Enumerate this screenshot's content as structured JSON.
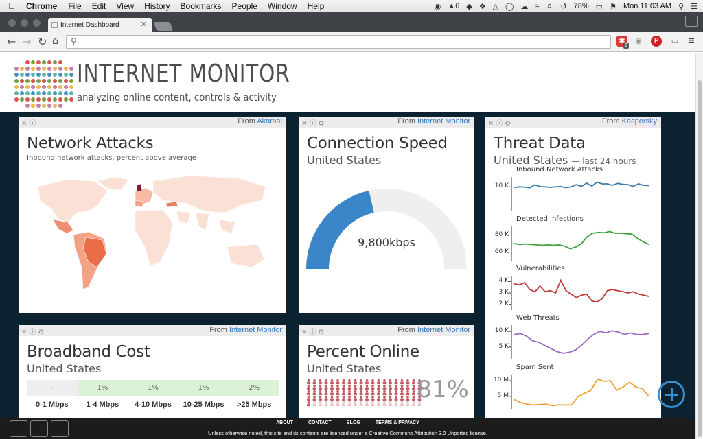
{
  "menubar": {
    "items": [
      "Chrome",
      "File",
      "Edit",
      "View",
      "History",
      "Bookmarks",
      "People",
      "Window",
      "Help"
    ],
    "status": {
      "adobe_count": "6",
      "battery": "78%",
      "clock": "Mon 11:03 AM"
    }
  },
  "browser": {
    "tab_title": "Internet Dashboard",
    "ext_badge": "2"
  },
  "site": {
    "title": "INTERNET MONITOR",
    "tagline": "analyzing online content, controls & activity"
  },
  "cards": {
    "attacks": {
      "source_prefix": "From",
      "source": "Akamai",
      "title": "Network Attacks",
      "desc": "Inbound network attacks, percent above average"
    },
    "speed": {
      "source_prefix": "From",
      "source": "Internet Monitor",
      "title": "Connection Speed",
      "country": "United States",
      "value": "9,800kbps",
      "fill_fraction": 0.43
    },
    "threat": {
      "source_prefix": "From",
      "source": "Kaspersky",
      "title": "Threat Data",
      "country": "United States",
      "period": "— last 24 hours"
    },
    "cost": {
      "source_prefix": "From",
      "source": "Internet Monitor",
      "title": "Broadband Cost",
      "country": "United States",
      "values": [
        "-",
        "1%",
        "1%",
        "1%",
        "2%"
      ],
      "tiers": [
        "0-1 Mbps",
        "1-4 Mbps",
        "4-10 Mbps",
        "10-25 Mbps",
        ">25 Mbps"
      ]
    },
    "online": {
      "source_prefix": "From",
      "source": "Internet Monitor",
      "title": "Percent Online",
      "country": "United States",
      "value": "81%",
      "percent": 81
    }
  },
  "chart_data": [
    {
      "type": "line",
      "title": "Inbound Network Attacks",
      "y_ticks": [
        "10 K"
      ],
      "ylim": [
        0,
        14000
      ],
      "color": "#3a7bab",
      "values": [
        9800,
        10000,
        9900,
        9600,
        10800,
        10100,
        10000,
        9800,
        10000,
        10100,
        9700,
        10000,
        10900,
        10200,
        11500,
        10300,
        11900,
        11200,
        11200,
        10600,
        11400,
        11000,
        10900,
        10200,
        11200,
        10600,
        10500
      ]
    },
    {
      "type": "line",
      "title": "Detected Infections",
      "y_ticks": [
        "80 K",
        "60 K"
      ],
      "ylim": [
        50000,
        90000
      ],
      "color": "#3aa23a",
      "values": [
        70000,
        69000,
        69500,
        69000,
        68500,
        68000,
        68500,
        68000,
        68500,
        67000,
        64000,
        66000,
        70000,
        78000,
        82000,
        83000,
        82500,
        84000,
        82000,
        82000,
        81500,
        81000,
        76000,
        72000,
        69000
      ]
    },
    {
      "type": "line",
      "title": "Vulnerabilities",
      "y_ticks": [
        "4 K",
        "3 K",
        "2 K"
      ],
      "ylim": [
        1500,
        4500
      ],
      "color": "#c0393b",
      "values": [
        3800,
        3700,
        3900,
        3300,
        3100,
        3600,
        3100,
        3200,
        3000,
        4100,
        3200,
        2900,
        2600,
        2800,
        2900,
        2300,
        2200,
        2500,
        3200,
        3300,
        3200,
        3100,
        3000,
        3100,
        2900,
        2800,
        2700
      ]
    },
    {
      "type": "line",
      "title": "Web Threats",
      "y_ticks": [
        "10 K",
        "5 K"
      ],
      "ylim": [
        1000,
        12000
      ],
      "color": "#9b6ac8",
      "values": [
        9000,
        9300,
        8500,
        7000,
        6500,
        5500,
        4500,
        3500,
        3000,
        3300,
        4000,
        5500,
        7500,
        9000,
        10000,
        9500,
        10200,
        9800,
        9000,
        9500,
        9000,
        9000,
        9300
      ]
    },
    {
      "type": "line",
      "title": "Spam Sent",
      "y_ticks": [
        "10 M",
        "5 M"
      ],
      "ylim": [
        1000000,
        12000000
      ],
      "color": "#f0a030",
      "values": [
        4000000,
        3000000,
        2500000,
        2200000,
        2400000,
        2500000,
        2000000,
        2300000,
        2200000,
        2300000,
        5000000,
        6000000,
        7000000,
        10500000,
        9800000,
        10000000,
        7000000,
        8000000,
        9500000,
        8000000,
        7500000,
        5000000
      ]
    },
    {
      "type": "map",
      "title": "Network Attacks",
      "highlight_countries": [
        "United Kingdom",
        "Brazil",
        "Turkey",
        "Mexico",
        "Spain"
      ]
    }
  ],
  "footer": {
    "links": [
      "ABOUT",
      "CONTACT",
      "BLOG",
      "TERMS & PRIVACY"
    ],
    "license": "Unless otherwise noted, this site and its contents are licensed under a Creative Commons Attribution 3.0 Unported license."
  },
  "colors": {
    "dashboard_bg": "#0d2230",
    "link": "#3a78b8",
    "gauge_fill": "#3a86c8",
    "gauge_track": "#efefef",
    "people_icon": "#c25b62"
  }
}
